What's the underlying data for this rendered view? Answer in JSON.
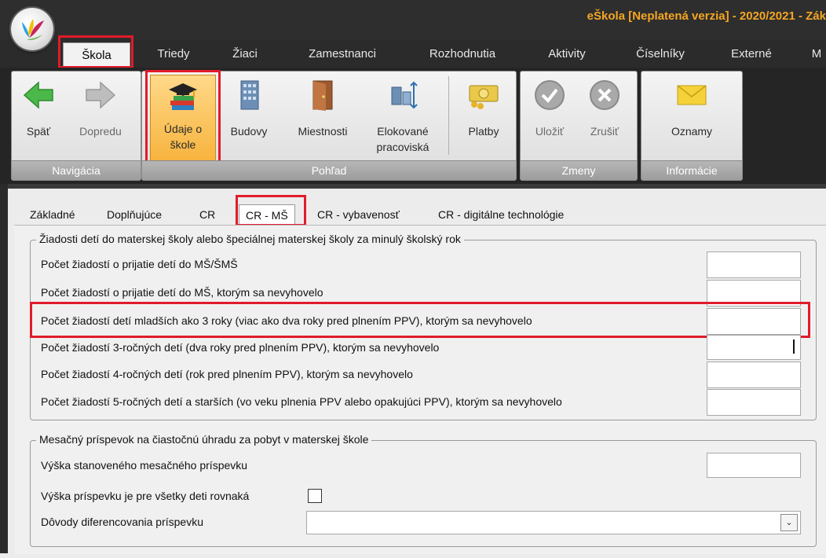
{
  "app": {
    "title": "eŠkola [Neplatená verzia] - 2020/2021 - Zák"
  },
  "main_tabs": [
    {
      "label": "Škola"
    },
    {
      "label": "Triedy"
    },
    {
      "label": "Žiaci"
    },
    {
      "label": "Zamestnanci"
    },
    {
      "label": "Rozhodnutia"
    },
    {
      "label": "Aktivity"
    },
    {
      "label": "Číselníky"
    },
    {
      "label": "Externé"
    },
    {
      "label": "M"
    }
  ],
  "ribbon": {
    "groups": {
      "navigation": "Navigácia",
      "view": "Pohľad",
      "changes": "Zmeny",
      "info": "Informácie"
    },
    "buttons": {
      "back": "Späť",
      "forward": "Dopredu",
      "school_data_1": "Údaje o",
      "school_data_2": "škole",
      "buildings": "Budovy",
      "rooms": "Miestnosti",
      "detached_1": "Elokované",
      "detached_2": "pracoviská",
      "payments": "Platby",
      "save": "Uložiť",
      "cancel": "Zrušiť",
      "notices": "Oznamy"
    }
  },
  "sub_tabs": [
    {
      "label": "Základné"
    },
    {
      "label": "Doplňujúce"
    },
    {
      "label": "CR"
    },
    {
      "label": "CR - MŠ"
    },
    {
      "label": "CR - vybavenosť"
    },
    {
      "label": "CR - digitálne technológie"
    }
  ],
  "section1": {
    "legend": "Žiadosti detí do materskej školy alebo špeciálnej materskej školy za minulý školský rok",
    "rows": [
      {
        "label": "Počet žiadostí o prijatie detí do MŠ/ŠMŠ",
        "value": ""
      },
      {
        "label": "Počet žiadostí o prijatie detí do MŠ, ktorým sa nevyhovelo",
        "value": ""
      },
      {
        "label": "Počet žiadostí detí mladších ako 3 roky (viac ako dva roky pred plnením PPV), ktorým sa nevyhovelo",
        "value": ""
      },
      {
        "label": "Počet žiadostí 3-ročných detí (dva roky pred plnením PPV), ktorým sa nevyhovelo",
        "value": ""
      },
      {
        "label": "Počet žiadostí 4-ročných detí (rok pred plnením PPV), ktorým sa nevyhovelo",
        "value": ""
      },
      {
        "label": "Počet žiadostí 5-ročných detí a starších (vo veku plnenia PPV alebo opakujúci PPV), ktorým sa nevyhovelo",
        "value": ""
      }
    ]
  },
  "section2": {
    "legend": "Mesačný príspevok na čiastočnú úhradu za pobyt v materskej škole",
    "amount_label": "Výška stanoveného mesačného príspevku",
    "amount_value": "",
    "equal_label": "Výška príspevku je pre všetky deti rovnaká",
    "equal_checked": false,
    "reasons_label": "Dôvody diferencovania príspevku",
    "reasons_value": ""
  },
  "colors": {
    "title": "#f5a623",
    "highlight": "#e11b2a",
    "selected_button": "#f7b23b"
  },
  "icons": [
    "app-logo",
    "back-arrow-icon",
    "forward-arrow-icon",
    "graduation-books-icon",
    "building-icon",
    "door-icon",
    "detached-sites-icon",
    "money-icon",
    "checkmark-icon",
    "x-cancel-icon",
    "envelope-icon",
    "chevron-down-icon"
  ]
}
